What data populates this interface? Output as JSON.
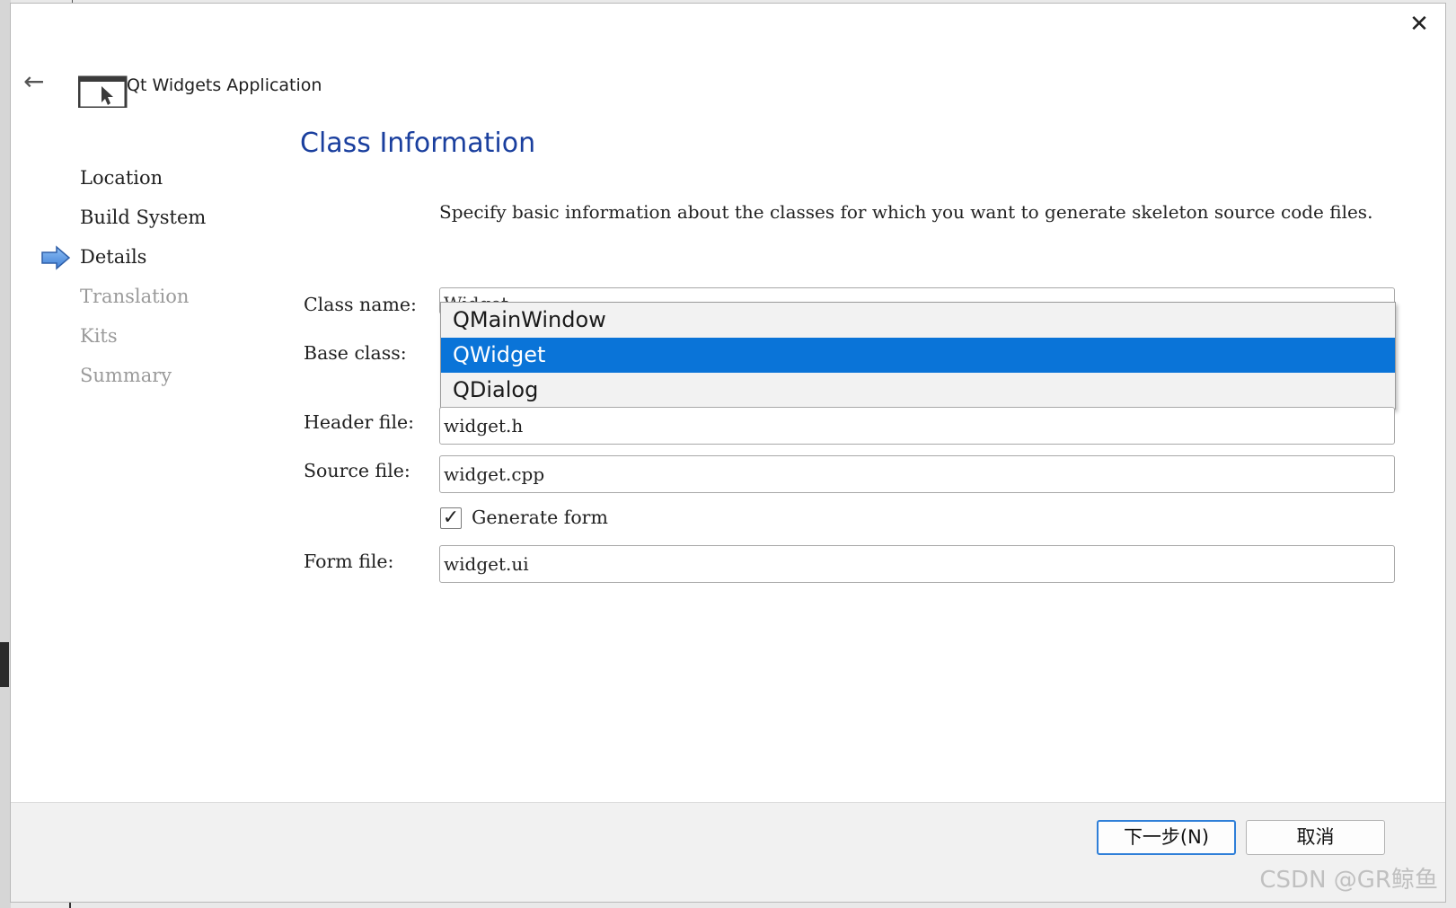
{
  "window": {
    "title": "Qt Widgets Application",
    "close_icon": "close-icon",
    "back_icon": "back-arrow-icon"
  },
  "steps": [
    {
      "label": "Location",
      "state": "done"
    },
    {
      "label": "Build System",
      "state": "done"
    },
    {
      "label": "Details",
      "state": "current"
    },
    {
      "label": "Translation",
      "state": "pending"
    },
    {
      "label": "Kits",
      "state": "pending"
    },
    {
      "label": "Summary",
      "state": "pending"
    }
  ],
  "page": {
    "title": "Class Information",
    "description": "Specify basic information about the classes for which you want to generate skeleton source code files."
  },
  "form": {
    "class_name": {
      "label": "Class name:",
      "value": "Widget"
    },
    "base_class": {
      "label": "Base class:",
      "options": [
        "QMainWindow",
        "QWidget",
        "QDialog"
      ],
      "selected": "QWidget"
    },
    "header_file": {
      "label": "Header file:",
      "value": "widget.h"
    },
    "source_file": {
      "label": "Source file:",
      "value": "widget.cpp"
    },
    "generate_form": {
      "label": "Generate form",
      "checked": true,
      "check_glyph": "✓"
    },
    "form_file": {
      "label": "Form file:",
      "value": "widget.ui"
    }
  },
  "footer": {
    "next_label": "下一步(N)",
    "cancel_label": "取消"
  },
  "watermark": "CSDN @GR鲸鱼",
  "colors": {
    "title_blue": "#1a3f9e",
    "selection_blue": "#0a74d8",
    "arrow_blue": "#4a90e2"
  }
}
